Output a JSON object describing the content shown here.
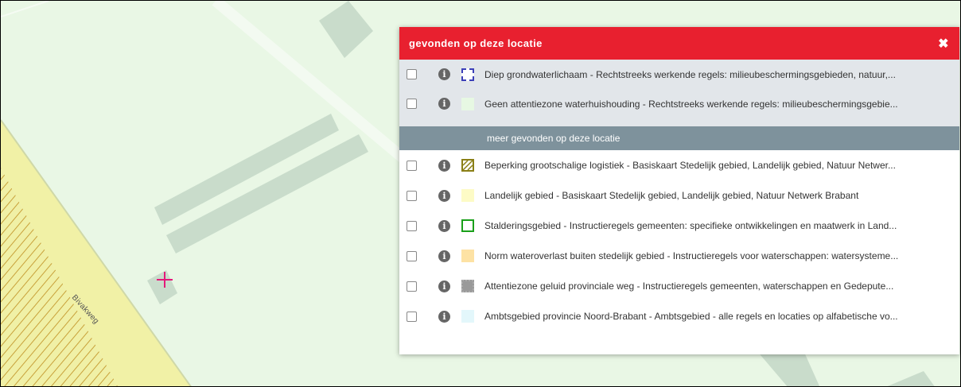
{
  "map": {
    "road_label": "Bivakweg",
    "colors": {
      "background": "#e9f7e5",
      "road": "#f1f1a6",
      "road_edge": "#cfd8a8",
      "hatch": "#c8a13a",
      "building": "#c9dccb",
      "marker": "#e4197a"
    }
  },
  "panel": {
    "title": "gevonden op deze locatie",
    "close_icon": "close-icon",
    "highlighted_items": [
      {
        "label": "Diep grondwaterlichaam - Rechtstreeks werkende regels: milieubeschermingsgebieden, natuur,...",
        "symbol": "dashed-blue-box"
      },
      {
        "label": "Geen attentiezone waterhuishouding - Rechtstreeks werkende regels: milieubeschermingsgebie...",
        "symbol": "light-green-fill"
      }
    ],
    "more_label": "meer gevonden op deze locatie",
    "items": [
      {
        "label": "Beperking grootschalige logistiek - Basiskaart Stedelijk gebied, Landelijk gebied, Natuur Netwer...",
        "symbol": "olive-hatched-box"
      },
      {
        "label": "Landelijk gebied - Basiskaart Stedelijk gebied, Landelijk gebied, Natuur Netwerk Brabant",
        "symbol": "pale-yellow-fill"
      },
      {
        "label": "Stalderingsgebied - Instructieregels gemeenten: specifieke ontwikkelingen en maatwerk in Land...",
        "symbol": "green-outline-box"
      },
      {
        "label": "Norm wateroverlast buiten stedelijk gebied - Instructieregels voor waterschappen: watersysteme...",
        "symbol": "orange-fill"
      },
      {
        "label": "Attentiezone geluid provinciale weg - Instructieregels gemeenten, waterschappen en Gedepute...",
        "symbol": "grey-dotted-fill"
      },
      {
        "label": "Ambtsgebied provincie Noord-Brabant - Ambtsgebied - alle regels en locaties op alfabetische vo...",
        "symbol": "light-cyan-fill"
      }
    ]
  }
}
